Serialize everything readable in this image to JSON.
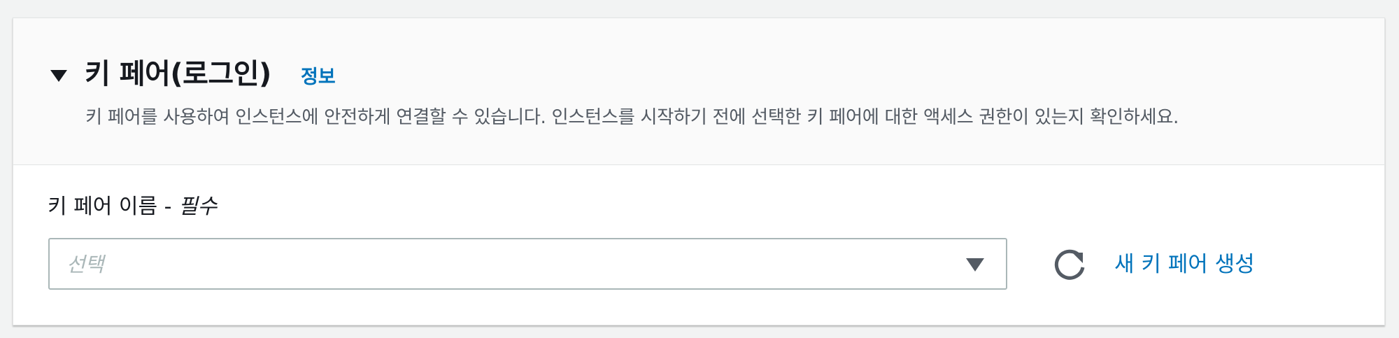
{
  "key_pair_section": {
    "title": "키 페어(로그인)",
    "info_link": "정보",
    "description": "키 페어를 사용하여 인스턴스에 안전하게 연결할 수 있습니다. 인스턴스를 시작하기 전에 선택한 키 페어에 대한 액세스 권한이 있는지 확인하세요.",
    "toggle_icon": "caret-down-icon"
  },
  "key_pair_field": {
    "label": "키 페어 이름 - ",
    "required_label": "필수",
    "placeholder": "선택",
    "dropdown_icon": "caret-down-icon",
    "refresh_icon": "refresh-icon",
    "create_link": "새 키 페어 생성"
  },
  "colors": {
    "link": "#0073bb",
    "text": "#16191f",
    "secondary_text": "#545b64",
    "border": "#aab7b8",
    "icon": "#545b64"
  }
}
